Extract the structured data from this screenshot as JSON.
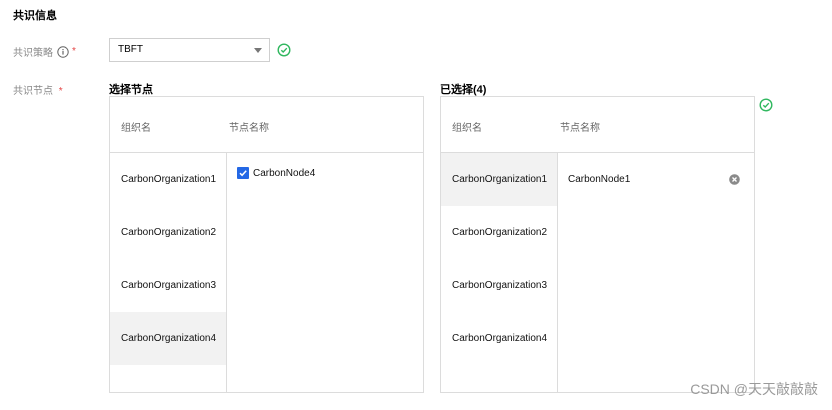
{
  "section": {
    "title": "共识信息"
  },
  "strategy": {
    "label": "共识策略",
    "required_mark": "*",
    "selected": "TBFT"
  },
  "nodes": {
    "label": "共识节点",
    "required_mark": "*"
  },
  "left_panel": {
    "title": "选择节点",
    "col_org": "组织名",
    "col_node": "节点名称",
    "orgs": [
      "CarbonOrganization1",
      "CarbonOrganization2",
      "CarbonOrganization3",
      "CarbonOrganization4"
    ],
    "active_org_index": 3,
    "nodes": [
      {
        "name": "CarbonNode4",
        "checked": true
      }
    ]
  },
  "right_panel": {
    "title": "已选择(4)",
    "col_org": "组织名",
    "col_node": "节点名称",
    "orgs": [
      "CarbonOrganization1",
      "CarbonOrganization2",
      "CarbonOrganization3",
      "CarbonOrganization4"
    ],
    "active_org_index": 0,
    "nodes": [
      {
        "name": "CarbonNode1"
      }
    ]
  },
  "watermark": "CSDN @天天敲敲敲",
  "colors": {
    "accent_blue": "#2468e5",
    "success_green": "#2fb75e",
    "required_red": "#e54545"
  }
}
